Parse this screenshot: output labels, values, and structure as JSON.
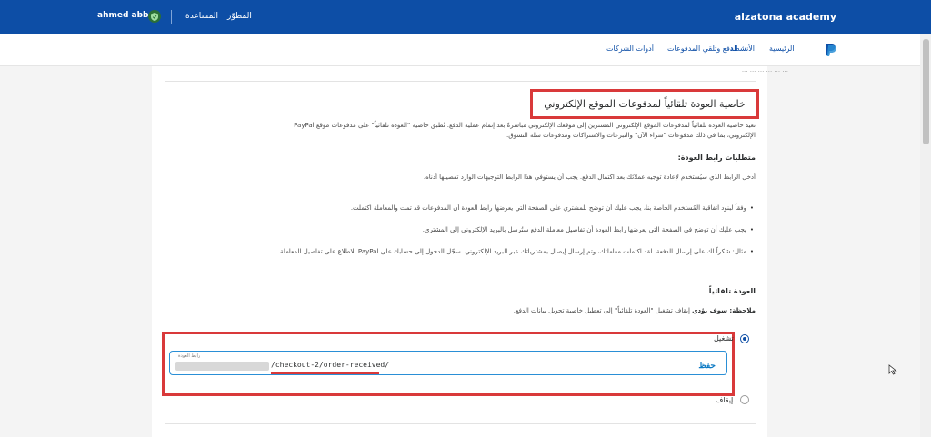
{
  "topbar": {
    "brand": "alzatona academy",
    "user_name": "ahmed abbas",
    "help": "المساعدة",
    "developer": "المطوّر"
  },
  "nav": {
    "items": [
      "الرئيسية",
      "الأنشطة",
      "الدفع وتلقي المدفوعات",
      "أدوات الشركات"
    ]
  },
  "section": {
    "cutoff": "... ... ... ... ... ...",
    "title": "خاصية العودة تلقائياً لمدفوعات الموقع الإلكتروني",
    "intro_1": "تعيد خاصية العودة تلقائياً لمدفوعات الموقع الإلكتروني المشترين إلى موقعك الإلكتروني مباشرةً بعد إتمام عملية الدفع. تُطبق خاصية \"العودة تلقائياً\" على مدفوعات موقع PayPal",
    "intro_2": "الإلكتروني، بما في ذلك مدفوعات \"شراء الآن\" والتبرعات والاشتراكات ومدفوعات سلة التسوق.",
    "requirements_heading": "متطلبات رابط العودة:",
    "requirements_desc": "أدخل الرابط الذي سيُستخدم لإعادة توجيه عملائك بعد اكتمال الدفع. يجب أن يستوفي هذا الرابط التوجيهات الوارد تفصيلها أدناه.",
    "bullets": [
      "وفقاً لبنود اتفاقية المُستخدم الخاصة بنا، يجب عليك أن توضح للمشتري على الصفحة التي يعرضها رابط العودة أن المدفوعات قد تمت والمعاملة اكتملت.",
      "يجب عليك أن توضح في الصفحة التي يعرضها رابط العودة أن تفاصيل معاملة الدفع ستُرسل بالبريد الإلكتروني إلى المشتري.",
      "مثال: شكراً لك على إرسال الدفعة. لقد اكتملت معاملتك، وتم إرسال إيصال بمشترياتك عبر البريد الإلكتروني. سجّل الدخول إلى حسابك على PayPal للاطلاع على تفاصيل المعاملة."
    ],
    "auto_return_heading": "العودة تلقائياً",
    "note_label": "ملاحظة: سوف يؤدي",
    "note_rest": "إيقاف تشغيل \"العودة تلقائياً\" إلى تعطيل خاصية تحويل بيانات الدفع.",
    "on_label": "تشغيل",
    "off_label": "إيقاف",
    "url_label": "رابط العودة",
    "url_value": "/checkout-2/order-received/",
    "save_label": "حفظ"
  },
  "colors": {
    "brand_blue": "#0d4ea6",
    "highlight_red": "#d9393a",
    "link_blue": "#0d7ac4"
  }
}
